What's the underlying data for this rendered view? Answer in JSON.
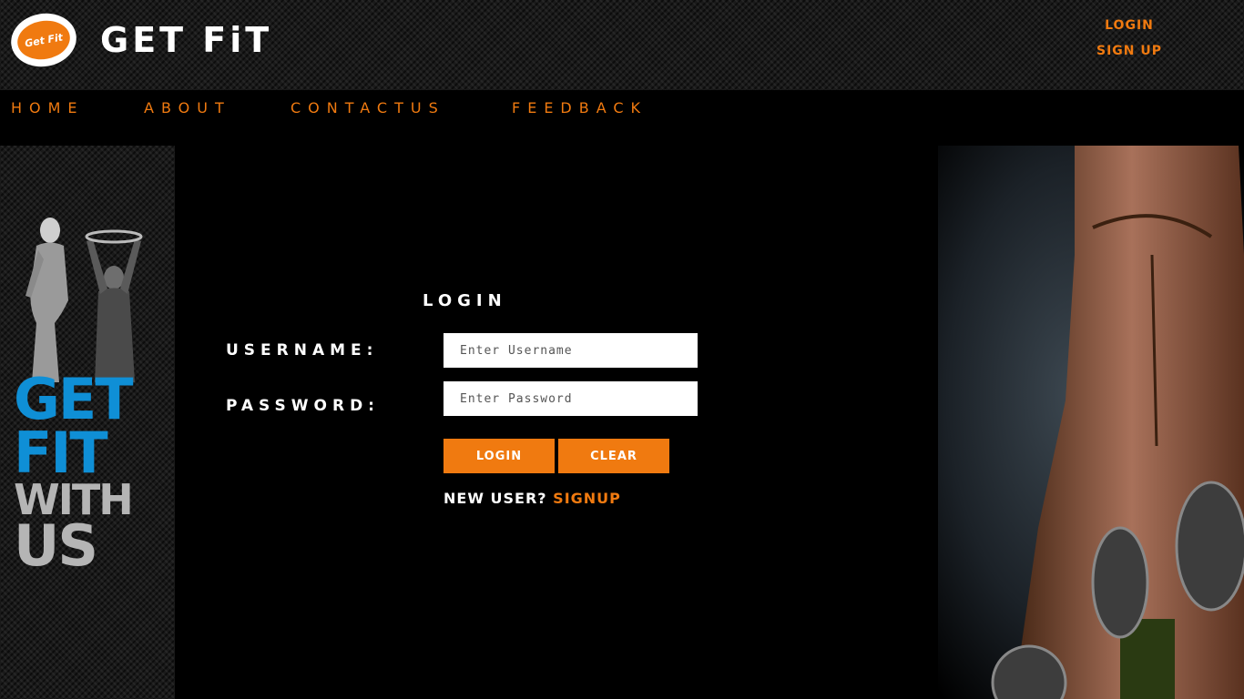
{
  "header": {
    "logo_text": "Get Fit",
    "brand": "GET FiT",
    "login_link": "LOGIN",
    "signup_link": "SIGN UP"
  },
  "nav": {
    "items": [
      "HOME",
      "ABOUT",
      "CONTACTUS",
      "FEEDBACK"
    ]
  },
  "side_banner": {
    "line1": "GET",
    "line2": "FIT",
    "line3": "WITH",
    "line4": "US"
  },
  "login": {
    "title": "LOGIN",
    "username_label": "USERNAME:",
    "username_placeholder": "Enter Username",
    "password_label": "PASSWORD:",
    "password_placeholder": "Enter Password",
    "login_button": "LOGIN",
    "clear_button": "CLEAR",
    "new_user_text": "NEW USER?",
    "signup_link": "SIGNUP"
  },
  "colors": {
    "accent": "#f07a10",
    "banner_blue": "#0f8fd6",
    "banner_grey": "#b5b5b5",
    "background": "#000000"
  }
}
